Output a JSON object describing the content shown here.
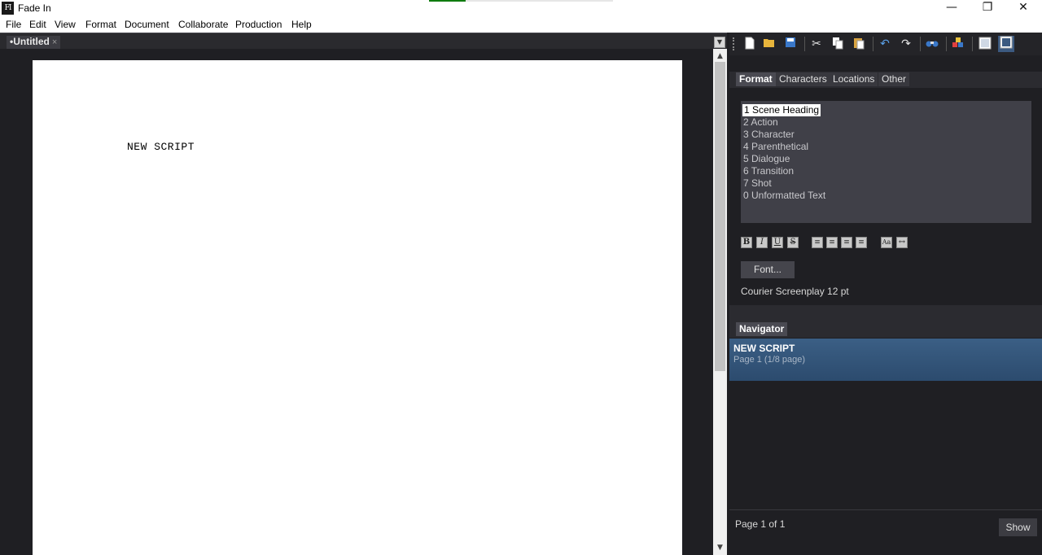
{
  "window": {
    "title": "Fade In",
    "icon_text": "FI",
    "progress": 0.2,
    "minimize_glyph": "—",
    "maximize_glyph": "❐",
    "close_glyph": "✕"
  },
  "menu": [
    "File",
    "Edit",
    "View",
    "Format",
    "Document",
    "Collaborate",
    "Production",
    "Help"
  ],
  "document_tab": {
    "label": "•Untitled",
    "close_glyph": "×"
  },
  "editor": {
    "scene_heading": "NEW SCRIPT"
  },
  "toolbar": {
    "icons": [
      "new-document",
      "open-folder",
      "save",
      "cut",
      "copy",
      "paste",
      "undo",
      "redo",
      "find",
      "highlight",
      "single-page-view",
      "side-panel-view"
    ]
  },
  "format_panel": {
    "tabs": [
      "Format",
      "Characters",
      "Locations",
      "Other"
    ],
    "active_tab": "Format",
    "elements": [
      "1 Scene Heading",
      "2 Action",
      "3 Character",
      "4 Parenthetical",
      "5 Dialogue",
      "6 Transition",
      "7 Shot",
      "0 Unformatted Text"
    ],
    "selected_element": "1 Scene Heading",
    "style_buttons": {
      "bold": "B",
      "italic": "I",
      "underline": "U",
      "strike": "S",
      "case": "Aa"
    },
    "font_button": "Font...",
    "font_info": "Courier Screenplay 12 pt"
  },
  "navigator": {
    "tab": "Navigator",
    "items": [
      {
        "title": "NEW SCRIPT",
        "subtitle": "Page 1 (1/8 page)"
      }
    ]
  },
  "footer": {
    "page_count": "Page 1 of 1",
    "show_button": "Show"
  }
}
